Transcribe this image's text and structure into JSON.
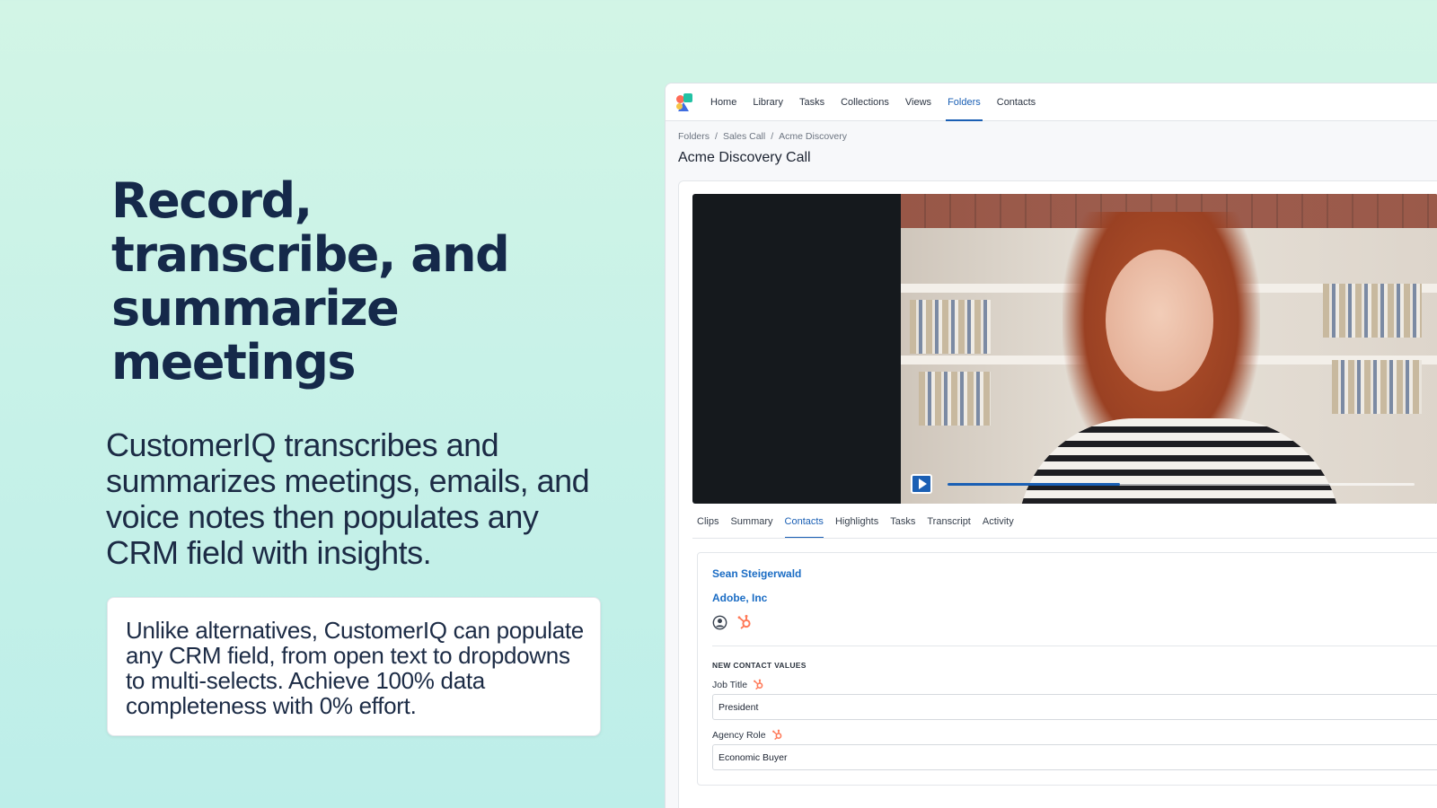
{
  "hero": {
    "title": "Record, transcribe, and summarize meetings",
    "subtitle": "CustomerIQ transcribes and summarizes meetings, emails, and voice notes then populates any CRM field with insights.",
    "callout": "Unlike alternatives, CustomerIQ can populate any CRM field, from open text to dropdowns to multi-selects. Achieve 100% data completeness with 0% effort."
  },
  "app": {
    "nav": [
      "Home",
      "Library",
      "Tasks",
      "Collections",
      "Views",
      "Folders",
      "Contacts"
    ],
    "active_nav": "Folders",
    "breadcrumb": [
      "Folders",
      "/",
      "Sales Call",
      "/",
      "Acme Discovery"
    ],
    "page_title": "Acme Discovery Call",
    "video": {
      "progress": 0.37
    },
    "tabs": [
      "Clips",
      "Summary",
      "Contacts",
      "Highlights",
      "Tasks",
      "Transcript",
      "Activity"
    ],
    "active_tab": "Contacts",
    "contact": {
      "name": "Sean Steigerwald",
      "company": "Adobe, Inc",
      "icons": [
        "user-circle-icon",
        "hubspot-icon"
      ],
      "section_label": "NEW CONTACT VALUES",
      "fields": [
        {
          "label": "Job Title",
          "value": "President"
        },
        {
          "label": "Agency Role",
          "value": "Economic Buyer"
        }
      ]
    }
  },
  "colors": {
    "accent": "#1a5fb4",
    "link": "#1a6cc4",
    "hubspot": "#ff7a59",
    "heading": "#15294a"
  }
}
